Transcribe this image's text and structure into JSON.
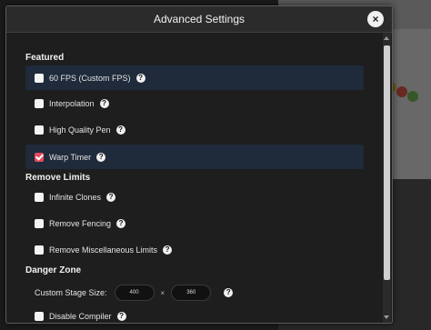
{
  "modal": {
    "title": "Advanced Settings",
    "close_label": "×"
  },
  "sections": {
    "featured": "Featured",
    "remove_limits": "Remove Limits",
    "danger_zone": "Danger Zone"
  },
  "options": {
    "fps": {
      "label": "60 FPS (Custom FPS)",
      "checked": false
    },
    "interpolation": {
      "label": "Interpolation",
      "checked": false
    },
    "hq_pen": {
      "label": "High Quality Pen",
      "checked": false
    },
    "warp_timer": {
      "label": "Warp Timer",
      "checked": true
    },
    "infinite_clones": {
      "label": "Infinite Clones",
      "checked": false
    },
    "remove_fencing": {
      "label": "Remove Fencing",
      "checked": false
    },
    "remove_misc": {
      "label": "Remove Miscellaneous Limits",
      "checked": false
    },
    "disable_compiler": {
      "label": "Disable Compiler",
      "checked": false
    }
  },
  "stage_size": {
    "label": "Custom Stage Size:",
    "width": "400",
    "height": "360",
    "separator": "×"
  },
  "help_glyph": "?",
  "colors": {
    "checked_accent": "#e24b5b",
    "row_highlight": "#1f2a3a",
    "modal_bg": "#1e1e1e"
  }
}
